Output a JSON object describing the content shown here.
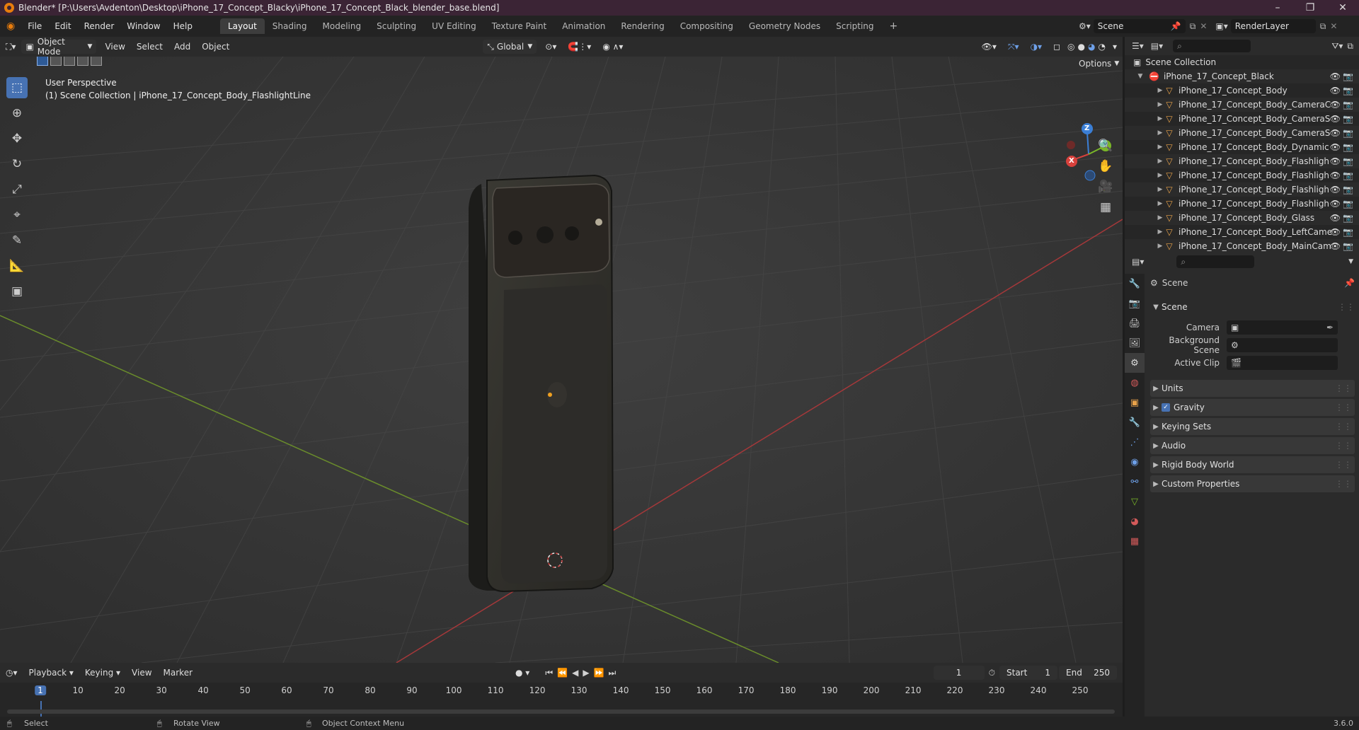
{
  "window": {
    "title": "Blender* [P:\\Users\\Avdenton\\Desktop\\iPhone_17_Concept_Blacky\\iPhone_17_Concept_Black_blender_base.blend]"
  },
  "menu": {
    "items": [
      "File",
      "Edit",
      "Render",
      "Window",
      "Help"
    ]
  },
  "workspaces": [
    "Layout",
    "Shading",
    "Modeling",
    "Sculpting",
    "UV Editing",
    "Texture Paint",
    "Animation",
    "Rendering",
    "Compositing",
    "Geometry Nodes",
    "Scripting"
  ],
  "top_right": {
    "scene": "Scene",
    "view_layer": "RenderLayer"
  },
  "viewport_header": {
    "mode": "Object Mode",
    "menus": [
      "View",
      "Select",
      "Add",
      "Object"
    ],
    "orientation": "Global",
    "options": "Options"
  },
  "viewport": {
    "view_name": "User Perspective",
    "context": "(1) Scene Collection | iPhone_17_Concept_Body_FlashlightLine",
    "axes": {
      "x": "X",
      "y": "Y",
      "z": "Z"
    }
  },
  "outliner": {
    "root": "Scene Collection",
    "collection": "iPhone_17_Concept_Black",
    "items": [
      "iPhone_17_Concept_Body",
      "iPhone_17_Concept_Body_CameraC",
      "iPhone_17_Concept_Body_CameraS",
      "iPhone_17_Concept_Body_CameraS",
      "iPhone_17_Concept_Body_Dynamic",
      "iPhone_17_Concept_Body_Flashligh",
      "iPhone_17_Concept_Body_Flashligh",
      "iPhone_17_Concept_Body_Flashligh",
      "iPhone_17_Concept_Body_Flashligh",
      "iPhone_17_Concept_Body_Glass",
      "iPhone_17_Concept_Body_LeftCame",
      "iPhone_17_Concept_Body_MainCam"
    ]
  },
  "properties": {
    "header": "Scene",
    "section": "Scene",
    "fields": [
      {
        "label": "Camera"
      },
      {
        "label": "Background Scene"
      },
      {
        "label": "Active Clip"
      }
    ],
    "panels": [
      "Units",
      "Gravity",
      "Keying Sets",
      "Audio",
      "Rigid Body World",
      "Custom Properties"
    ]
  },
  "timeline": {
    "menus": [
      "Playback",
      "Keying",
      "View",
      "Marker"
    ],
    "current_frame": "1",
    "start_label": "Start",
    "start": "1",
    "end_label": "End",
    "end": "250",
    "ticks": [
      "1",
      "10",
      "20",
      "30",
      "40",
      "50",
      "60",
      "70",
      "80",
      "90",
      "100",
      "110",
      "120",
      "130",
      "140",
      "150",
      "160",
      "170",
      "180",
      "190",
      "200",
      "210",
      "220",
      "230",
      "240",
      "250"
    ]
  },
  "status": {
    "select": "Select",
    "rotate": "Rotate View",
    "context_menu": "Object Context Menu",
    "version": "3.6.0"
  },
  "colors": {
    "accent": "#4772b3",
    "title_bar": "#3b2435",
    "x_axis": "#d8413c",
    "y_axis": "#7ab728",
    "z_axis": "#3b7fd6",
    "mesh_icon": "#e8a24a"
  }
}
